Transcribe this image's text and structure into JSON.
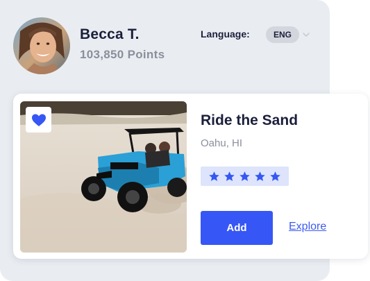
{
  "profile": {
    "name": "Becca T.",
    "points": "103,850 Points"
  },
  "language": {
    "label": "Language:",
    "selected": "ENG"
  },
  "card": {
    "title": "Ride the Sand",
    "location": "Oahu, HI",
    "rating": 5,
    "favorited": true,
    "add_label": "Add",
    "explore_label": "Explore"
  },
  "colors": {
    "accent": "#3657f5",
    "panel_bg": "#e9edf1",
    "star": "#3657f5",
    "star_bg": "#dde4fb"
  },
  "icons": {
    "favorite": "heart-icon",
    "dropdown": "chevron-down-icon",
    "rating": "star-icon"
  }
}
